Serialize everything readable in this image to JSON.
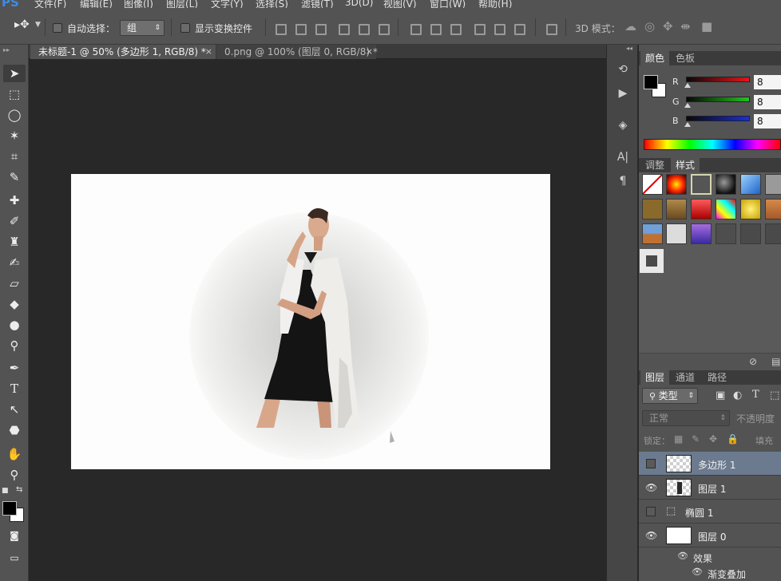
{
  "menubar": {
    "logo": "PS",
    "items": [
      "文件(F)",
      "编辑(E)",
      "图像(I)",
      "图层(L)",
      "文字(Y)",
      "选择(S)",
      "滤镜(T)",
      "3D(D)",
      "视图(V)",
      "窗口(W)",
      "帮助(H)"
    ]
  },
  "options": {
    "auto_select_label": "自动选择：",
    "auto_select_value": "组",
    "show_transform_label": "显示变换控件",
    "mode_3d_label": "3D 模式："
  },
  "tabs": [
    {
      "label": "未标题-1 @ 50% (多边形 1, RGB/8) *",
      "close": "×"
    },
    {
      "label": "0.png @ 100% (图层 0, RGB/8) *",
      "close": "×"
    }
  ],
  "color_panel": {
    "tabs": [
      "颜色",
      "色板"
    ],
    "channels": [
      {
        "label": "R",
        "value": "8",
        "color": "#e8141a"
      },
      {
        "label": "G",
        "value": "8",
        "color": "#22c21f"
      },
      {
        "label": "B",
        "value": "8",
        "color": "#1a2ee0"
      }
    ]
  },
  "styles_panel": {
    "tabs": [
      "调整",
      "样式"
    ]
  },
  "layers_panel": {
    "tabs": [
      "图层",
      "通道",
      "路径"
    ],
    "filter_label": "类型",
    "blend_mode": "正常",
    "opacity_label": "不透明度",
    "lock_label": "锁定：",
    "fill_label": "填充",
    "layers": [
      {
        "name": "多边形 1",
        "visible": false,
        "selected": true
      },
      {
        "name": "图层 1",
        "visible": true,
        "selected": false
      },
      {
        "name": "椭圆 1",
        "visible": false,
        "selected": false
      },
      {
        "name": "图层 0",
        "visible": true,
        "selected": false
      }
    ],
    "effects_label": "效果",
    "effect_item": "渐变叠加"
  },
  "colors": {
    "foreground": "#000000",
    "background": "#ffffff",
    "accent_selected_layer": "#6b7a8e"
  }
}
